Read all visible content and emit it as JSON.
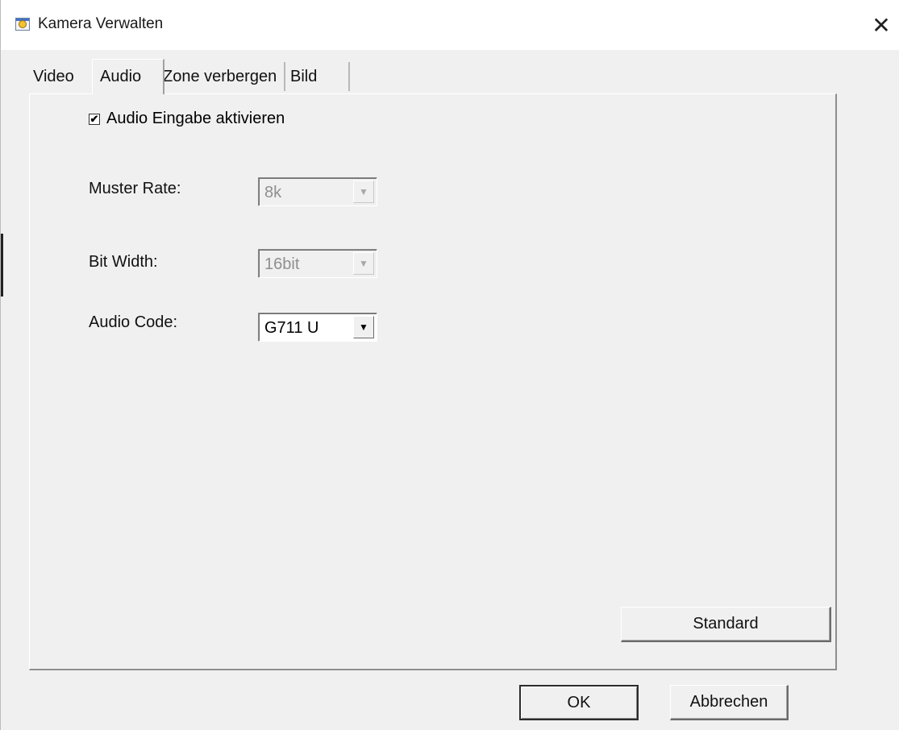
{
  "window": {
    "title": "Kamera Verwalten",
    "close_glyph": "✕",
    "icon": "camera-app-icon"
  },
  "tabs": [
    {
      "label": "Video",
      "active": false
    },
    {
      "label": "Audio",
      "active": true
    },
    {
      "label": "Zone verbergen",
      "active": false
    },
    {
      "label": "Bild",
      "active": false
    }
  ],
  "audio": {
    "enable_checkbox": {
      "label": "Audio Eingabe aktivieren",
      "checked": true,
      "mark": "✔"
    },
    "sample_rate": {
      "label": "Muster Rate:",
      "value": "8k",
      "enabled": false
    },
    "bit_width": {
      "label": "Bit Width:",
      "value": "16bit",
      "enabled": false
    },
    "audio_code": {
      "label": "Audio Code:",
      "value": "G711 U",
      "enabled": true
    },
    "arrow_glyph": "▼"
  },
  "buttons": {
    "standard": "Standard",
    "ok": "OK",
    "cancel": "Abbrechen"
  }
}
